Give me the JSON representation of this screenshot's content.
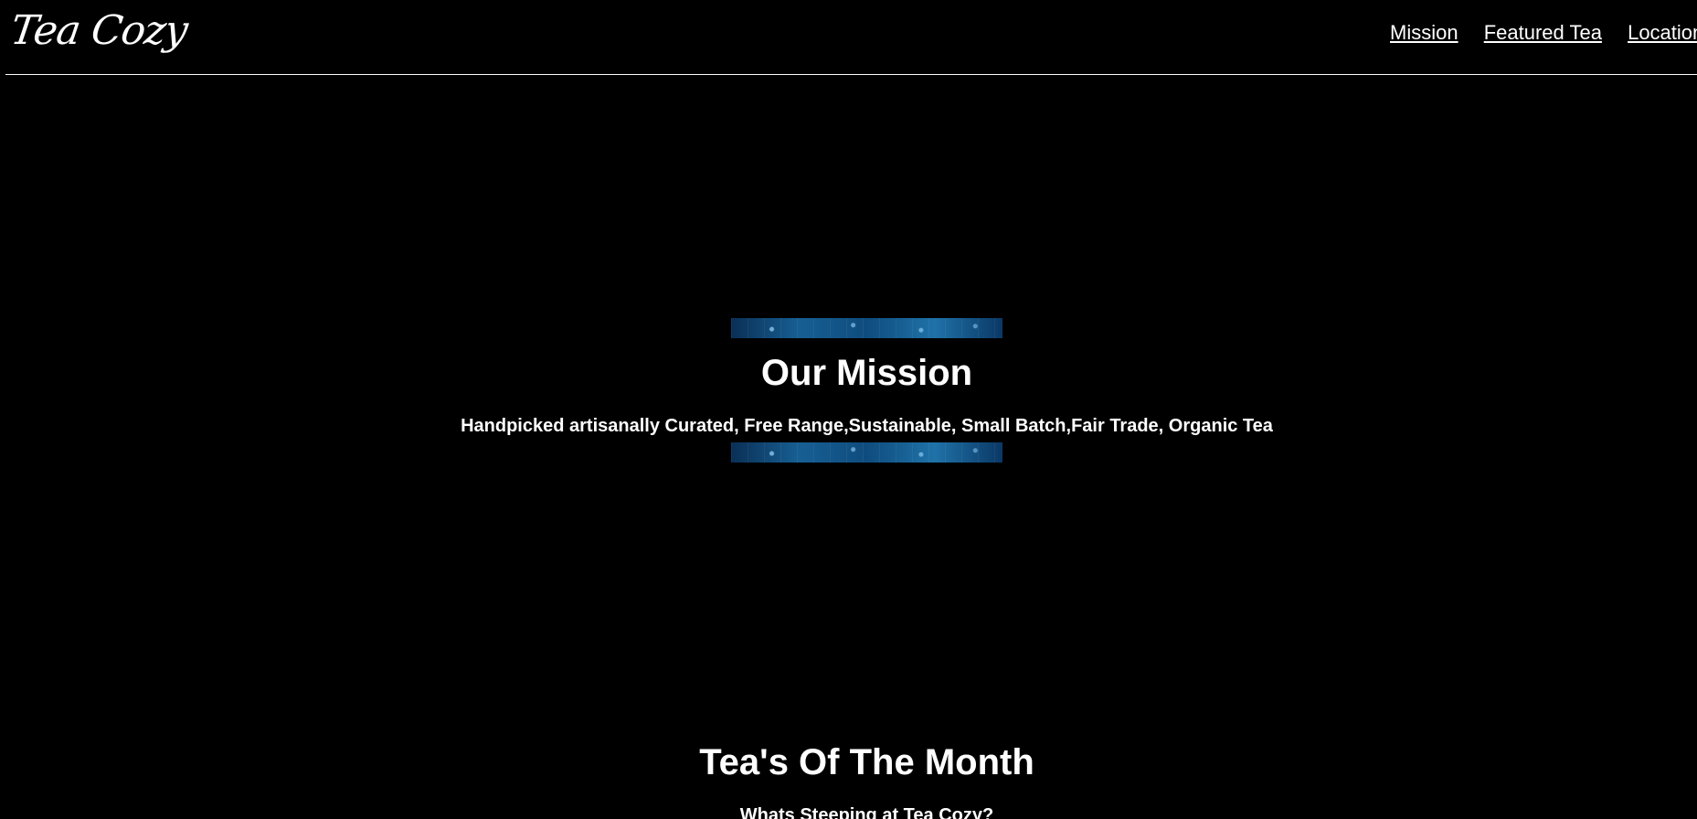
{
  "header": {
    "logo": "Tea Cozy",
    "nav": [
      {
        "label": "Mission"
      },
      {
        "label": "Featured Tea"
      },
      {
        "label": "Locations"
      }
    ]
  },
  "mission": {
    "title": "Our Mission",
    "text": "Handpicked artisanally Curated, Free Range,Sustainable, Small Batch,Fair Trade, Organic Tea"
  },
  "month": {
    "title": "Tea's Of The Month",
    "subtitle": "Whats Steeping at Tea Cozy?"
  },
  "colors": {
    "background": "#000000",
    "text": "#ffffff",
    "strip_accent": "#175f93"
  }
}
